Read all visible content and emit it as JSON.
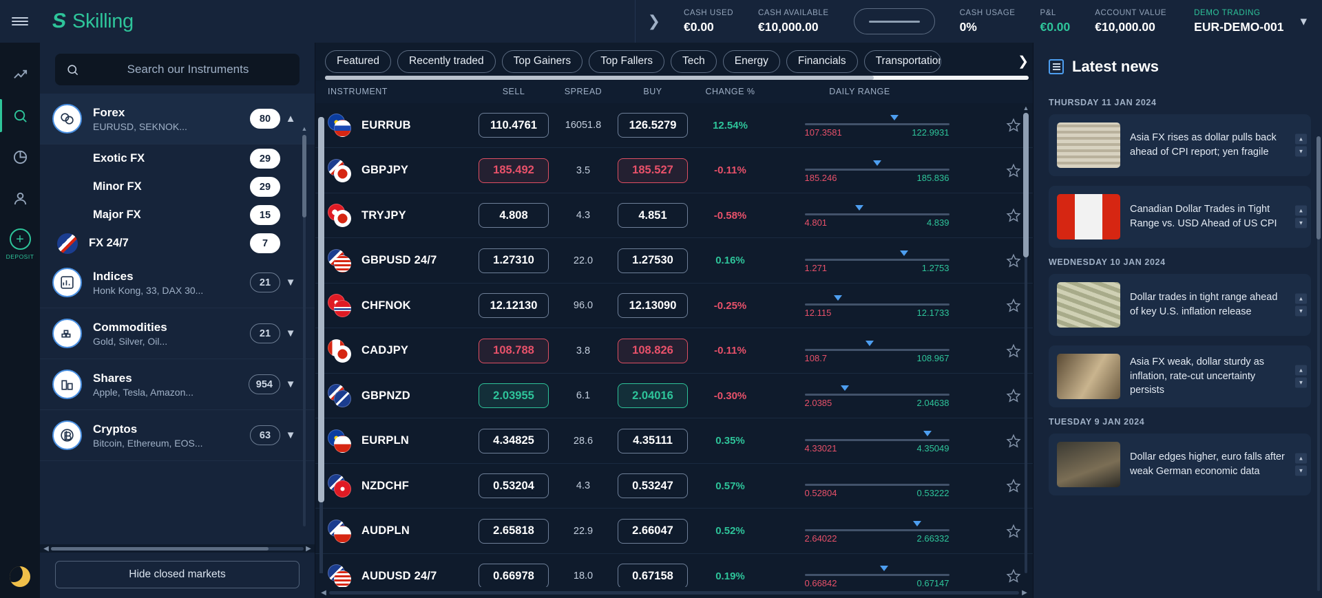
{
  "brand": {
    "name": "Skilling"
  },
  "topbar": {
    "stats": [
      {
        "label": "CASH USED",
        "value": "€0.00",
        "tone": "white"
      },
      {
        "label": "CASH AVAILABLE",
        "value": "€10,000.00",
        "tone": "white"
      }
    ],
    "stats_right": [
      {
        "label": "CASH USAGE",
        "value": "0%",
        "tone": "white"
      },
      {
        "label": "P&L",
        "value": "€0.00",
        "tone": "green"
      },
      {
        "label": "ACCOUNT VALUE",
        "value": "€10,000.00",
        "tone": "white"
      }
    ],
    "demo": {
      "label": "DEMO TRADING",
      "value": "EUR-DEMO-001"
    }
  },
  "rail": {
    "deposit_label": "DEPOSIT",
    "items": [
      {
        "name": "chart-icon"
      },
      {
        "name": "search-icon"
      },
      {
        "name": "pie-chart-icon"
      },
      {
        "name": "person-icon"
      }
    ]
  },
  "sidebar": {
    "search_placeholder": "Search our Instruments",
    "hide_closed_label": "Hide closed markets",
    "categories": [
      {
        "name": "Forex",
        "sub": "EURUSD, SEKNOK...",
        "count": "80",
        "expanded": true,
        "solid_badge": true,
        "children": [
          {
            "name": "Exotic FX",
            "count": "29",
            "flag": false
          },
          {
            "name": "Minor FX",
            "count": "29",
            "flag": false
          },
          {
            "name": "Major FX",
            "count": "15",
            "flag": false
          },
          {
            "name": "FX 24/7",
            "count": "7",
            "flag": true
          }
        ]
      },
      {
        "name": "Indices",
        "sub": "Honk Kong, 33, DAX 30...",
        "count": "21",
        "expanded": false,
        "solid_badge": false,
        "children": []
      },
      {
        "name": "Commodities",
        "sub": "Gold, Silver, Oil...",
        "count": "21",
        "expanded": false,
        "solid_badge": false,
        "children": []
      },
      {
        "name": "Shares",
        "sub": "Apple, Tesla, Amazon...",
        "count": "954",
        "expanded": false,
        "solid_badge": false,
        "children": []
      },
      {
        "name": "Cryptos",
        "sub": "Bitcoin, Ethereum, EOS...",
        "count": "63",
        "expanded": false,
        "solid_badge": false,
        "children": []
      }
    ]
  },
  "main": {
    "tabs": [
      {
        "label": "Featured",
        "active": false
      },
      {
        "label": "Recently traded",
        "active": false
      },
      {
        "label": "Top Gainers",
        "active": false
      },
      {
        "label": "Top Fallers",
        "active": false
      },
      {
        "label": "Tech",
        "active": false
      },
      {
        "label": "Energy",
        "active": false
      },
      {
        "label": "Financials",
        "active": false
      },
      {
        "label": "Transportation",
        "active": false
      }
    ],
    "columns": [
      "INSTRUMENT",
      "SELL",
      "SPREAD",
      "BUY",
      "CHANGE %",
      "DAILY RANGE"
    ],
    "rows": [
      {
        "instrument": "EURRUB",
        "sell": "110.4761",
        "spread": "16051.8",
        "buy": "126.5279",
        "change": "12.54%",
        "change_dir": "pos",
        "price_state": "neutral",
        "low": "107.3581",
        "high": "122.9931",
        "marker_pct": 62,
        "marker": true,
        "flag1": "eu",
        "flag2": "ru"
      },
      {
        "instrument": "GBPJPY",
        "sell": "185.492",
        "spread": "3.5",
        "buy": "185.527",
        "change": "-0.11%",
        "change_dir": "neg",
        "price_state": "down",
        "low": "185.246",
        "high": "185.836",
        "marker_pct": 50,
        "marker": true,
        "flag1": "gb",
        "flag2": "jp"
      },
      {
        "instrument": "TRYJPY",
        "sell": "4.808",
        "spread": "4.3",
        "buy": "4.851",
        "change": "-0.58%",
        "change_dir": "neg",
        "price_state": "neutral",
        "low": "4.801",
        "high": "4.839",
        "marker_pct": 38,
        "marker": true,
        "flag1": "tr",
        "flag2": "jp"
      },
      {
        "instrument": "GBPUSD 24/7",
        "sell": "1.27310",
        "spread": "22.0",
        "buy": "1.27530",
        "change": "0.16%",
        "change_dir": "pos",
        "price_state": "neutral",
        "low": "1.271",
        "high": "1.2753",
        "marker_pct": 69,
        "marker": true,
        "flag1": "gb",
        "flag2": "us"
      },
      {
        "instrument": "CHFNOK",
        "sell": "12.12130",
        "spread": "96.0",
        "buy": "12.13090",
        "change": "-0.25%",
        "change_dir": "neg",
        "price_state": "neutral",
        "low": "12.115",
        "high": "12.1733",
        "marker_pct": 23,
        "marker": true,
        "flag1": "ch",
        "flag2": "no"
      },
      {
        "instrument": "CADJPY",
        "sell": "108.788",
        "spread": "3.8",
        "buy": "108.826",
        "change": "-0.11%",
        "change_dir": "neg",
        "price_state": "down",
        "low": "108.7",
        "high": "108.967",
        "marker_pct": 45,
        "marker": true,
        "flag1": "ca",
        "flag2": "jp"
      },
      {
        "instrument": "GBPNZD",
        "sell": "2.03955",
        "spread": "6.1",
        "buy": "2.04016",
        "change": "-0.30%",
        "change_dir": "neg",
        "price_state": "up",
        "low": "2.0385",
        "high": "2.04638",
        "marker_pct": 28,
        "marker": true,
        "flag1": "gb",
        "flag2": "nz"
      },
      {
        "instrument": "EURPLN",
        "sell": "4.34825",
        "spread": "28.6",
        "buy": "4.35111",
        "change": "0.35%",
        "change_dir": "pos",
        "price_state": "neutral",
        "low": "4.33021",
        "high": "4.35049",
        "marker_pct": 85,
        "marker": true,
        "flag1": "eu",
        "flag2": "pl"
      },
      {
        "instrument": "NZDCHF",
        "sell": "0.53204",
        "spread": "4.3",
        "buy": "0.53247",
        "change": "0.57%",
        "change_dir": "pos",
        "price_state": "neutral",
        "low": "0.52804",
        "high": "0.53222",
        "marker_pct": 90,
        "marker": false,
        "flag1": "nz",
        "flag2": "ch"
      },
      {
        "instrument": "AUDPLN",
        "sell": "2.65818",
        "spread": "22.9",
        "buy": "2.66047",
        "change": "0.52%",
        "change_dir": "pos",
        "price_state": "neutral",
        "low": "2.64022",
        "high": "2.66332",
        "marker_pct": 78,
        "marker": true,
        "flag1": "au",
        "flag2": "pl"
      },
      {
        "instrument": "AUDUSD 24/7",
        "sell": "0.66978",
        "spread": "18.0",
        "buy": "0.67158",
        "change": "0.19%",
        "change_dir": "pos",
        "price_state": "neutral",
        "low": "0.66842",
        "high": "0.67147",
        "marker_pct": 55,
        "marker": true,
        "flag1": "au",
        "flag2": "us"
      }
    ]
  },
  "news": {
    "title": "Latest news",
    "groups": [
      {
        "date": "THURSDAY 11 JAN 2024",
        "items": [
          {
            "text": "Asia FX rises as dollar pulls back ahead of CPI report; yen fragile",
            "thumb": "banknotes"
          },
          {
            "text": "Canadian Dollar Trades in Tight Range vs. USD Ahead of US CPI",
            "thumb": "canada"
          }
        ]
      },
      {
        "date": "WEDNESDAY 10 JAN 2024",
        "items": [
          {
            "text": "Dollar trades in tight range ahead of key U.S. inflation release",
            "thumb": "dollars"
          },
          {
            "text": "Asia FX weak, dollar sturdy as inflation, rate-cut uncertainty persists",
            "thumb": "yen"
          }
        ]
      },
      {
        "date": "TUESDAY 9 JAN 2024",
        "items": [
          {
            "text": "Dollar edges higher, euro falls after weak German economic data",
            "thumb": "person"
          }
        ]
      }
    ]
  }
}
